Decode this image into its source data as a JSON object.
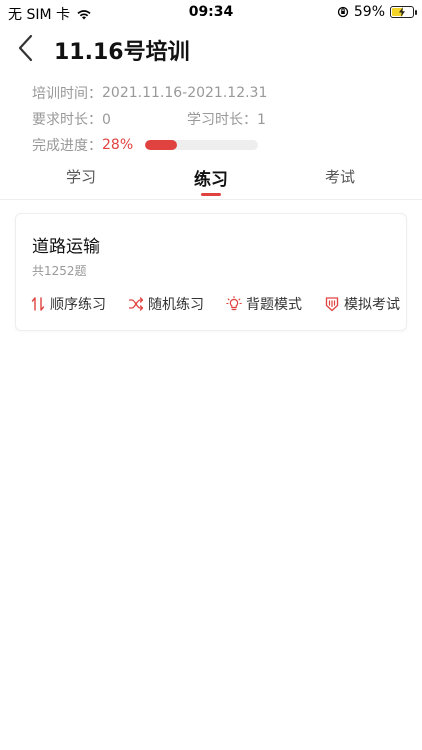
{
  "status": {
    "carrier": "无 SIM 卡",
    "time": "09:34",
    "battery_percent": "59%",
    "battery_level": 0.59
  },
  "nav": {
    "title": "11.16号培训"
  },
  "info": {
    "training_time_label": "培训时间：",
    "training_time_value": "2021.11.16-2021.12.31",
    "required_label": "要求时长：",
    "required_value": "0",
    "study_label": "学习时长：",
    "study_value": "1",
    "progress_label": "完成进度：",
    "progress_value": "28%",
    "progress_fraction": 0.28
  },
  "tabs": [
    {
      "label": "学习"
    },
    {
      "label": "练习"
    },
    {
      "label": "考试"
    }
  ],
  "card": {
    "title": "道路运输",
    "count": "共1252题",
    "actions": [
      {
        "label": "顺序练习",
        "icon": "sequence-icon"
      },
      {
        "label": "随机练习",
        "icon": "shuffle-icon"
      },
      {
        "label": "背题模式",
        "icon": "bulb-icon"
      },
      {
        "label": "模拟考试",
        "icon": "shield-icon"
      }
    ]
  },
  "colors": {
    "accent": "#e0423f",
    "battery": "#f3d428"
  }
}
